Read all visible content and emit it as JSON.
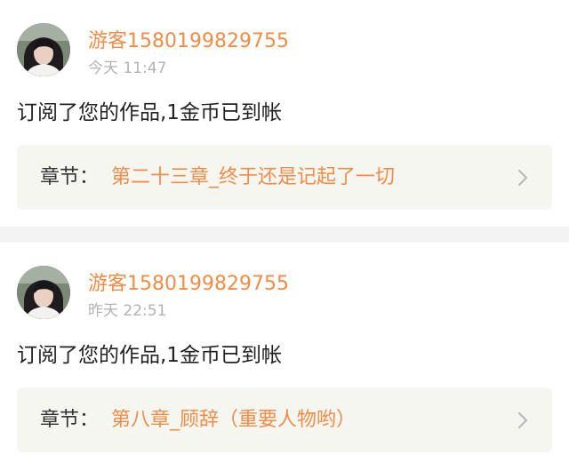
{
  "notifications": [
    {
      "username": "游客1580199829755",
      "time": "今天 11:47",
      "message": "订阅了您的作品,1金币已到帐",
      "chapter_prefix": "章节：",
      "chapter_title": "第二十三章_终于还是记起了一切",
      "avatar_icon": "user-avatar-photo",
      "chevron_icon": "chevron-right-icon"
    },
    {
      "username": "游客1580199829755",
      "time": "昨天 22:51",
      "message": "订阅了您的作品,1金币已到帐",
      "chapter_prefix": "章节：",
      "chapter_title": "第八章_顾辞（重要人物哟）",
      "avatar_icon": "user-avatar-photo",
      "chevron_icon": "chevron-right-icon"
    }
  ],
  "colors": {
    "accent_orange": "#f08c48",
    "timestamp_gray": "#b2b2b2",
    "text_dark": "#222222",
    "chapter_box_bg": "#f6f6f1",
    "separator_bg": "#f3f3f3"
  }
}
